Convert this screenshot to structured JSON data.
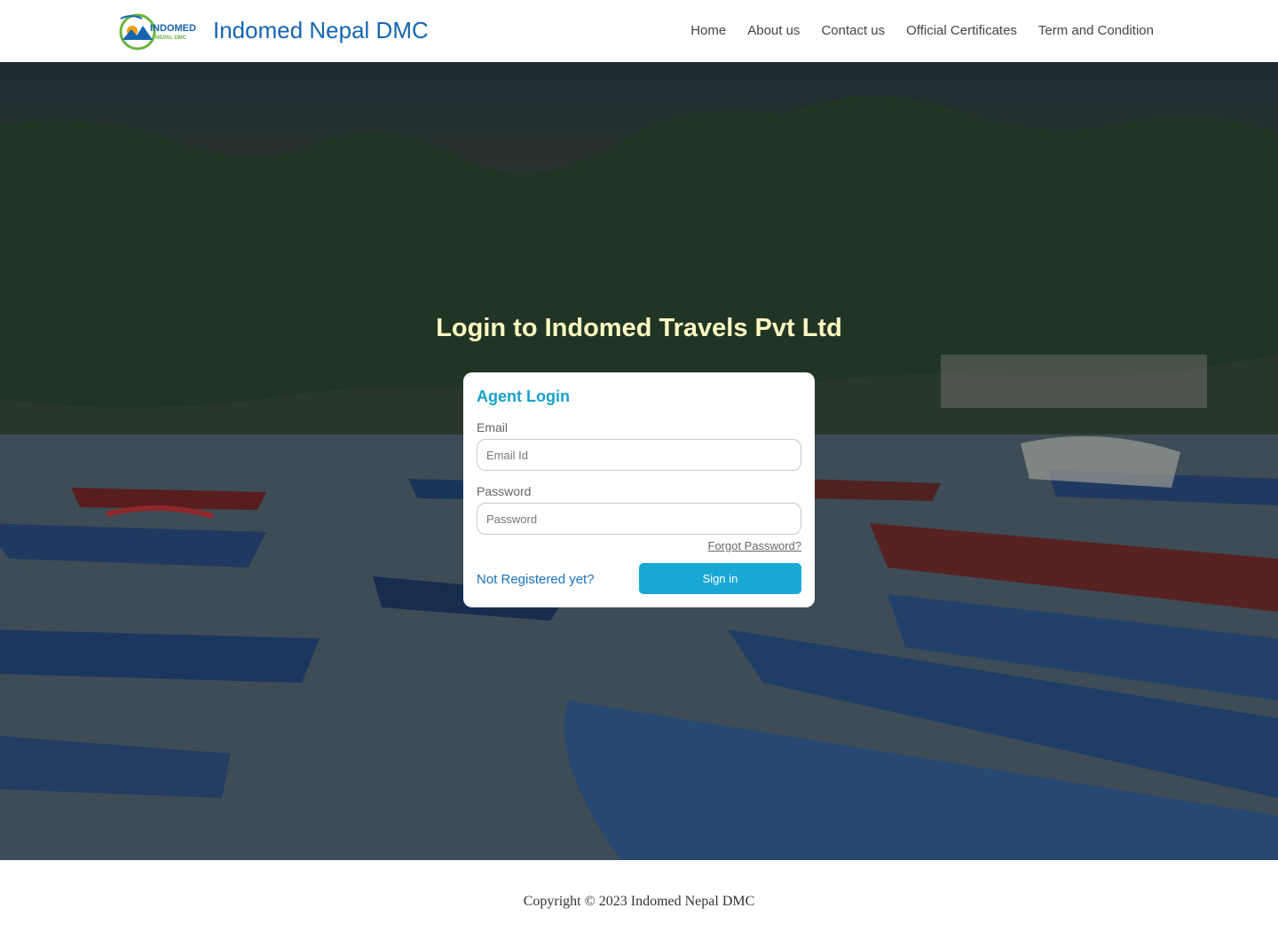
{
  "header": {
    "brand_name": "Indomed Nepal DMC",
    "logo": {
      "icon": "indomed-logo-icon",
      "text_top": "INDOMED",
      "text_bottom": "NEPAL DMC"
    },
    "nav": [
      {
        "label": "Home"
      },
      {
        "label": "About us"
      },
      {
        "label": "Contact us"
      },
      {
        "label": "Official Certificates"
      },
      {
        "label": "Term and Condition"
      }
    ]
  },
  "hero": {
    "title": "Login to Indomed Travels Pvt Ltd",
    "background": "lake-with-boats-and-mountains"
  },
  "login": {
    "title": "Agent Login",
    "email_label": "Email",
    "email_placeholder": "Email Id",
    "password_label": "Password",
    "password_placeholder": "Password",
    "forgot_label": "Forgot Password?",
    "register_label": "Not Registered yet?",
    "signin_label": "Sign in"
  },
  "footer": {
    "copyright": "Copyright © 2023 Indomed Nepal DMC"
  },
  "colors": {
    "brand_blue": "#1565b0",
    "accent_cyan": "#17a8d6",
    "hero_title": "#fff9c4",
    "link_blue": "#1a73b8"
  }
}
